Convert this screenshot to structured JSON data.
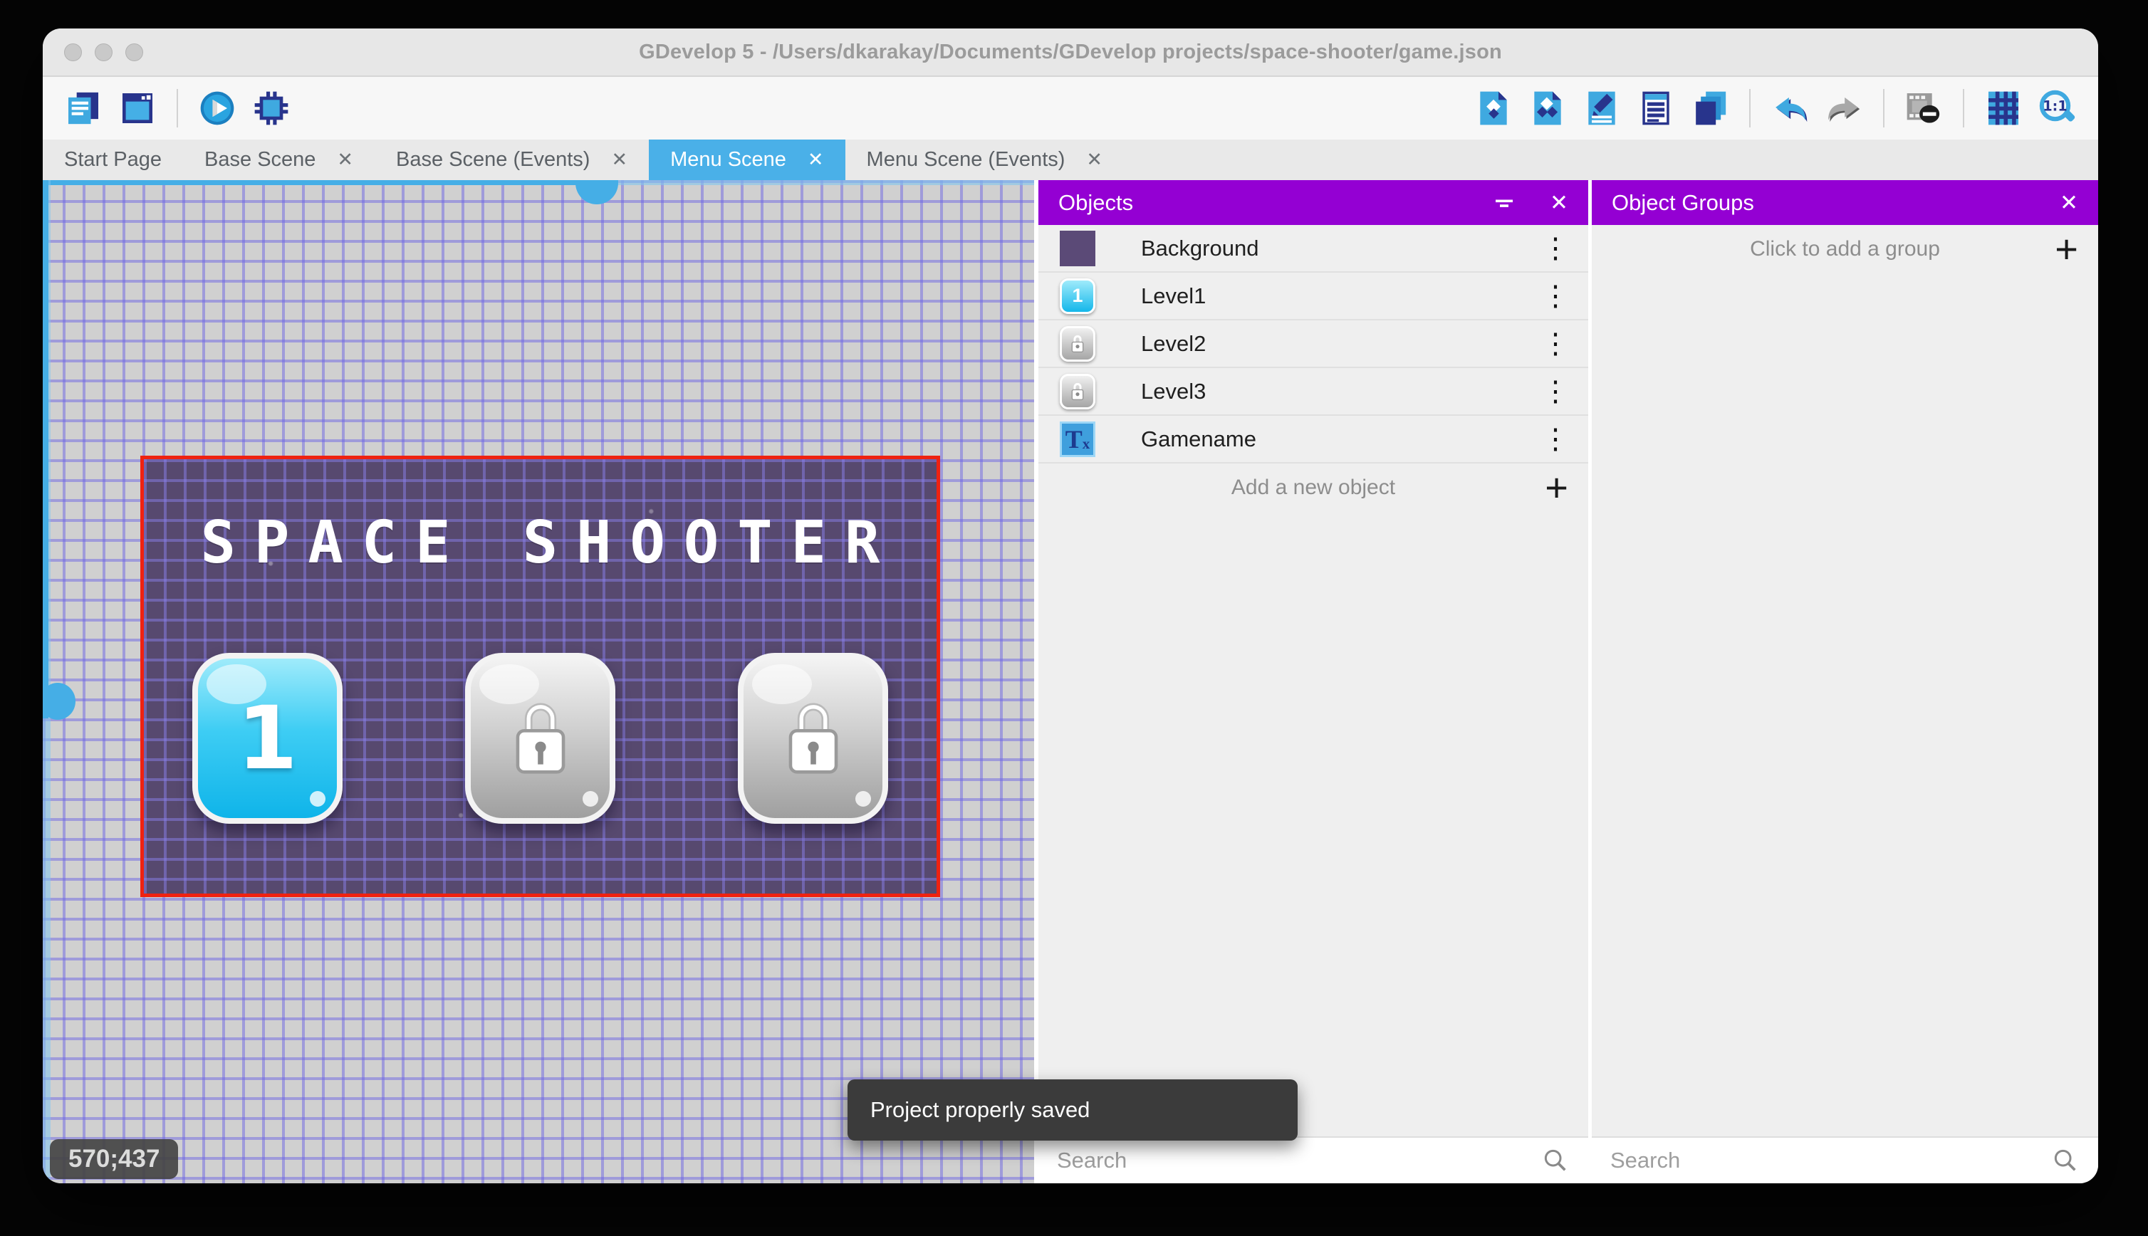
{
  "window": {
    "title": "GDevelop 5 - /Users/dkarakay/Documents/GDevelop projects/space-shooter/game.json"
  },
  "toolbar": {
    "left": [
      "project-manager",
      "scene-editor-window",
      "preview-play",
      "debug"
    ],
    "right": [
      "objects-panel",
      "object-groups-panel",
      "properties",
      "instances-list",
      "layers",
      "undo",
      "redo",
      "instances-mask",
      "grid",
      "zoom-1-1"
    ]
  },
  "tabs": [
    {
      "label": "Start Page",
      "closable": false,
      "active": false
    },
    {
      "label": "Base Scene",
      "closable": true,
      "active": false
    },
    {
      "label": "Base Scene (Events)",
      "closable": true,
      "active": false
    },
    {
      "label": "Menu Scene",
      "closable": true,
      "active": true
    },
    {
      "label": "Menu Scene (Events)",
      "closable": true,
      "active": false
    }
  ],
  "canvas": {
    "coordinates": "570;437",
    "scene": {
      "title": "SPACE SHOOTER",
      "level_buttons": [
        {
          "label": "1",
          "state": "unlocked"
        },
        {
          "label": "",
          "state": "locked"
        },
        {
          "label": "",
          "state": "locked"
        }
      ]
    }
  },
  "objects_panel": {
    "title": "Objects",
    "items": [
      {
        "name": "Background",
        "thumb": "purple-swatch"
      },
      {
        "name": "Level1",
        "thumb": "blue-button",
        "badge": "1"
      },
      {
        "name": "Level2",
        "thumb": "locked-button"
      },
      {
        "name": "Level3",
        "thumb": "locked-button"
      },
      {
        "name": "Gamename",
        "thumb": "text-object",
        "glyph_main": "T",
        "glyph_sub": "x"
      }
    ],
    "add_label": "Add a new object",
    "search_placeholder": "Search"
  },
  "object_groups_panel": {
    "title": "Object Groups",
    "empty_label": "Click to add a group",
    "search_placeholder": "Search"
  },
  "toast": {
    "message": "Project properly saved"
  },
  "icons": {
    "close": "✕",
    "kebab": "⋮",
    "plus": "+"
  },
  "colors": {
    "panel_header_purple": "#9400d3",
    "active_tab_blue": "#4ab0e8",
    "scene_background": "#57496f",
    "selection_red": "#ee2211",
    "scrollbar_blue": "#45aee6"
  }
}
